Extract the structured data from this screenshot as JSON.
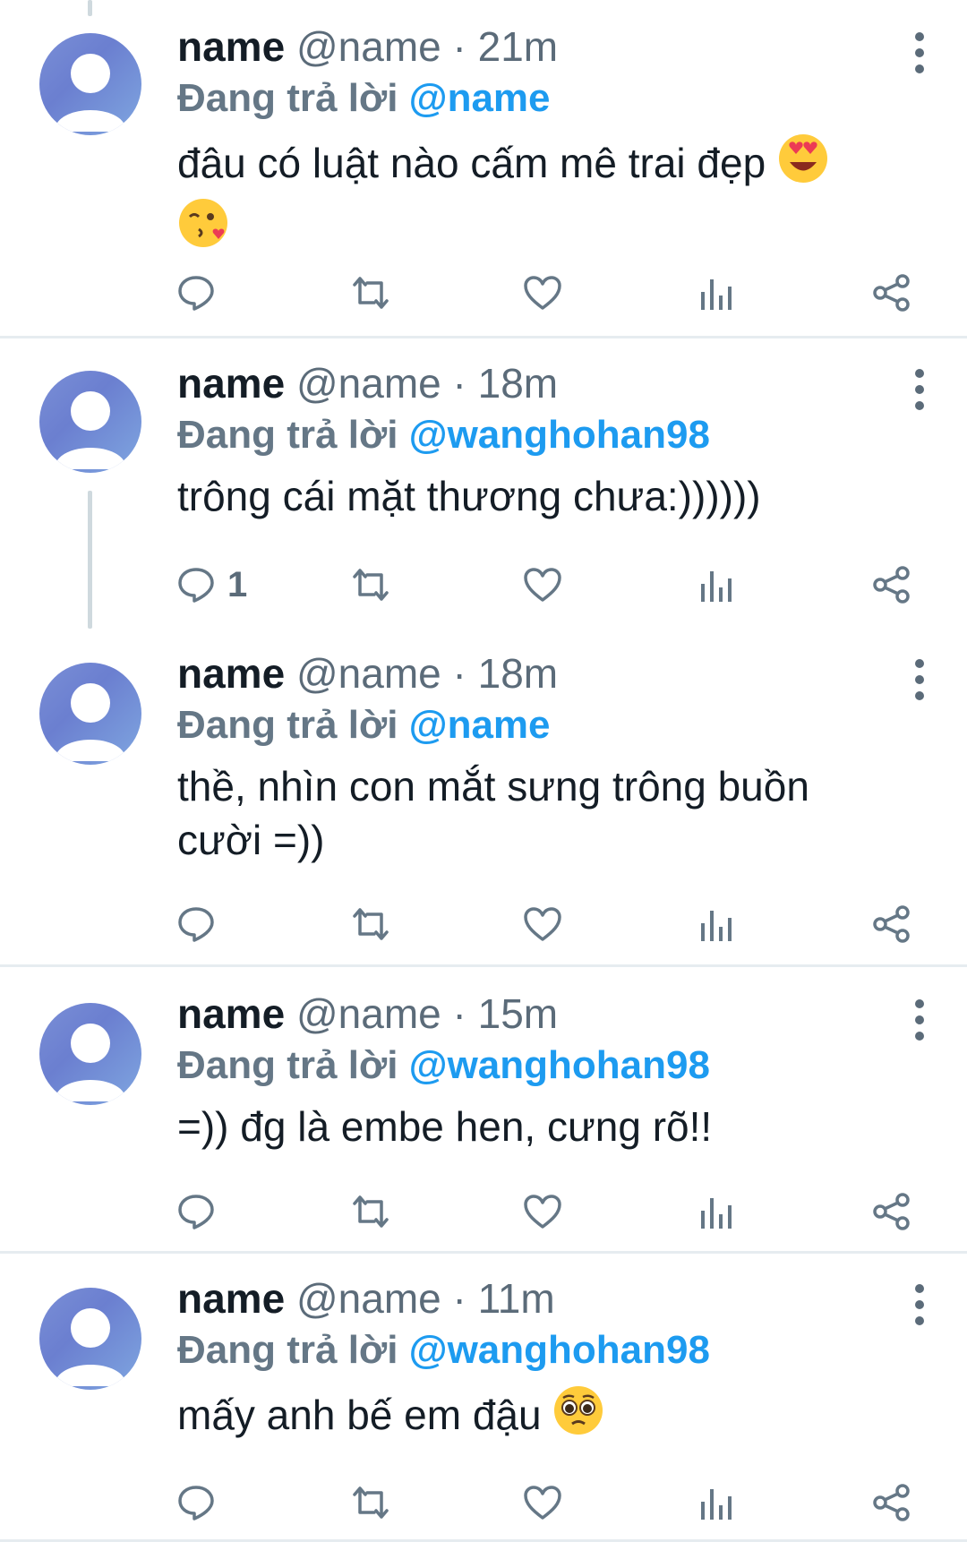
{
  "tweets": [
    {
      "display_name": "name",
      "handle": "@name",
      "separator": "·",
      "time": "21m",
      "reply_prefix": "Đang trả lời",
      "reply_to": "@name",
      "text_lines": [
        "đâu có luật nào cấm mê trai đẹp"
      ],
      "trailing_emoji": [
        "heart-eyes-emoji",
        "kissing-heart-emoji"
      ],
      "reply_count": ""
    },
    {
      "display_name": "name",
      "handle": "@name",
      "separator": "·",
      "time": "18m",
      "reply_prefix": "Đang trả lời",
      "reply_to": "@wanghohan98",
      "text_lines": [
        "trông cái mặt thương chưa:))))))"
      ],
      "reply_count": "1"
    },
    {
      "display_name": "name",
      "handle": "@name",
      "separator": "·",
      "time": "18m",
      "reply_prefix": "Đang trả lời",
      "reply_to": "@name",
      "text_lines": [
        "thề, nhìn con mắt sưng trông buồn",
        "cười =))"
      ],
      "reply_count": ""
    },
    {
      "display_name": "name",
      "handle": "@name",
      "separator": "·",
      "time": "15m",
      "reply_prefix": "Đang trả lời",
      "reply_to": "@wanghohan98",
      "text_lines": [
        "=)) đg là embe hen, cưng rõ!!"
      ],
      "reply_count": ""
    },
    {
      "display_name": "name",
      "handle": "@name",
      "separator": "·",
      "time": "11m",
      "reply_prefix": "Đang trả lời",
      "reply_to": "@wanghohan98",
      "text_lines": [
        "mấy anh bế em đậu"
      ],
      "trailing_emoji": [
        "pleading-face-emoji"
      ],
      "reply_count": ""
    }
  ],
  "colors": {
    "link": "#1d9bf0",
    "muted": "#657786",
    "text": "#141d26",
    "divider": "#e6ecf0",
    "thread_line": "#cfd9de"
  },
  "icons": [
    "reply-icon",
    "retweet-icon",
    "like-icon",
    "analytics-icon",
    "share-icon",
    "more-icon",
    "avatar-placeholder-icon"
  ]
}
